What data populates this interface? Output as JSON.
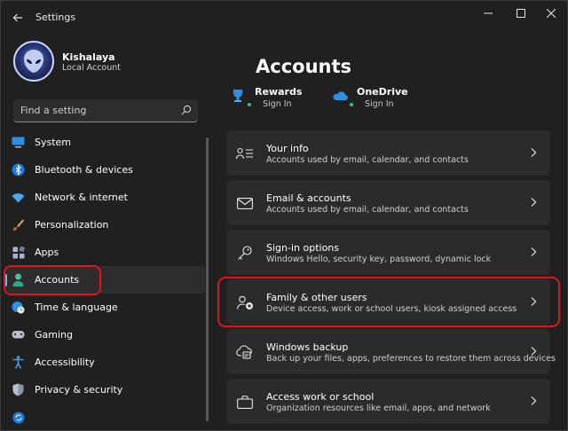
{
  "window": {
    "title": "Settings",
    "back_icon": "arrow-left-icon",
    "controls": [
      "minimize-icon",
      "maximize-icon",
      "close-icon"
    ]
  },
  "profile": {
    "name": "Kishalaya",
    "account_type": "Local Account"
  },
  "search": {
    "placeholder": "Find a setting"
  },
  "sidebar": {
    "items": [
      {
        "label": "System",
        "icon": "monitor-icon",
        "active": false
      },
      {
        "label": "Bluetooth & devices",
        "icon": "bluetooth-icon",
        "active": false
      },
      {
        "label": "Network & internet",
        "icon": "wifi-icon",
        "active": false
      },
      {
        "label": "Personalization",
        "icon": "brush-icon",
        "active": false
      },
      {
        "label": "Apps",
        "icon": "apps-grid-icon",
        "active": false
      },
      {
        "label": "Accounts",
        "icon": "person-icon",
        "active": true
      },
      {
        "label": "Time & language",
        "icon": "globe-clock-icon",
        "active": false
      },
      {
        "label": "Gaming",
        "icon": "gamepad-icon",
        "active": false
      },
      {
        "label": "Accessibility",
        "icon": "accessibility-icon",
        "active": false
      },
      {
        "label": "Privacy & security",
        "icon": "shield-icon",
        "active": false
      },
      {
        "label": "",
        "icon": "windows-update-icon",
        "active": false
      }
    ]
  },
  "main": {
    "title": "Accounts",
    "quick_links": [
      {
        "name": "Rewards",
        "status": "Sign In",
        "icon": "rewards-trophy-icon"
      },
      {
        "name": "OneDrive",
        "status": "Sign In",
        "icon": "onedrive-cloud-icon"
      }
    ],
    "cards": [
      {
        "title": "Your info",
        "description": "Accounts used by email, calendar, and contacts",
        "icon": "person-lines-icon"
      },
      {
        "title": "Email & accounts",
        "description": "Accounts used by email, calendar, and contacts",
        "icon": "mail-icon"
      },
      {
        "title": "Sign-in options",
        "description": "Windows Hello, security key, password, dynamic lock",
        "icon": "key-icon"
      },
      {
        "title": "Family & other users",
        "description": "Device access, work or school users, kiosk assigned access",
        "icon": "person-add-icon"
      },
      {
        "title": "Windows backup",
        "description": "Back up your files, apps, preferences to restore them across devices",
        "icon": "backup-icon"
      },
      {
        "title": "Access work or school",
        "description": "Organization resources like email, apps, and network",
        "icon": "briefcase-icon"
      }
    ]
  },
  "colors": {
    "accent": "#4cc2ff",
    "highlight": "#e0141e",
    "background": "#202020",
    "card": "#2b2b2b"
  }
}
